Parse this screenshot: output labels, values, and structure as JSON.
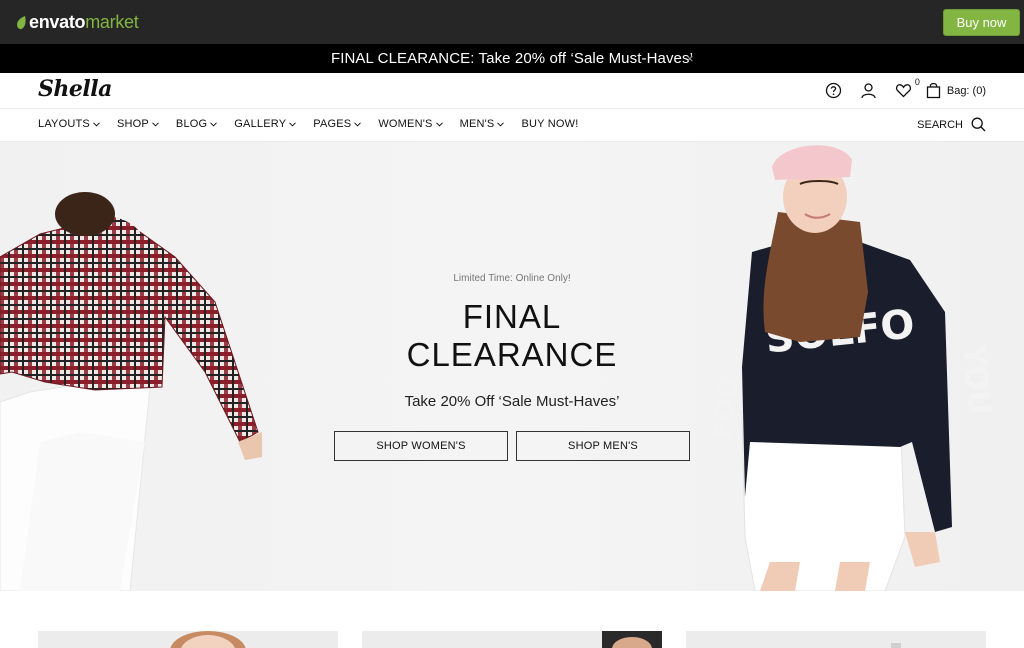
{
  "envato": {
    "logo_word1": "envato",
    "logo_word2": "market",
    "buy_now": "Buy now",
    "accent": "#82b541"
  },
  "announcement": {
    "text": "FINAL CLEARANCE: Take 20% off ‘Sale Must-Haves’",
    "close": "×"
  },
  "header": {
    "logo": "Shella",
    "icons": [
      "help-icon",
      "user-icon",
      "heart-icon",
      "bag-icon"
    ],
    "wishlist_count": "0",
    "bag_label": "Bag: (0)"
  },
  "nav": {
    "items": [
      {
        "label": "LAYOUTS",
        "dropdown": true
      },
      {
        "label": "SHOP",
        "dropdown": true
      },
      {
        "label": "BLOG",
        "dropdown": true
      },
      {
        "label": "GALLERY",
        "dropdown": true
      },
      {
        "label": "PAGES",
        "dropdown": true
      },
      {
        "label": "WOMEN'S",
        "dropdown": true
      },
      {
        "label": "MEN'S",
        "dropdown": true
      },
      {
        "label": "BUY NOW!",
        "dropdown": false
      }
    ],
    "search_label": "SEARCH"
  },
  "hero": {
    "kicker": "Limited Time: Online Only!",
    "title_line1": "FINAL",
    "title_line2": "CLEARANCE",
    "subtitle": "Take 20% Off ‘Sale Must-Haves’",
    "btn_women": "SHOP WOMEN'S",
    "btn_men": "SHOP MEN'S"
  }
}
